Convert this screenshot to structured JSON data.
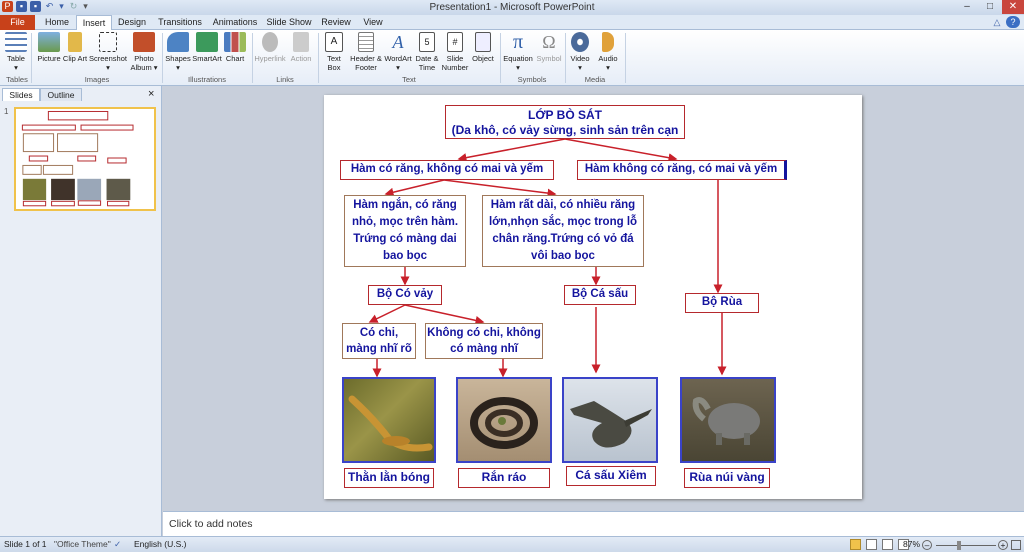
{
  "window": {
    "title": "Presentation1 - Microsoft PowerPoint"
  },
  "tabs": [
    "File",
    "Home",
    "Insert",
    "Design",
    "Transitions",
    "Animations",
    "Slide Show",
    "Review",
    "View"
  ],
  "ribbon": {
    "groups": {
      "tables": "Tables",
      "images": "Images",
      "illustrations": "Illustrations",
      "links": "Links",
      "text": "Text",
      "symbols": "Symbols",
      "media": "Media"
    },
    "buttons": {
      "table": "Table",
      "picture": "Picture",
      "clipart": "Clip Art",
      "screenshot": "Screenshot",
      "photoalbum": "Photo Album",
      "shapes": "Shapes",
      "smartart": "SmartArt",
      "chart": "Chart",
      "hyperlink": "Hyperlink",
      "action": "Action",
      "textbox": "Text Box",
      "headerfooter": "Header & Footer",
      "wordart": "WordArt",
      "datetime": "Date & Time",
      "slidenumber": "Slide Number",
      "object": "Object",
      "equation": "Equation",
      "symbol": "Symbol",
      "video": "Video",
      "audio": "Audio"
    }
  },
  "panel": {
    "tab_slides": "Slides",
    "tab_outline": "Outline",
    "close": "×",
    "slide_number": "1"
  },
  "slide": {
    "title_line1": "LỚP BÒ SÁT",
    "title_line2": "(Da khô, có vảy sừng, sinh sản trên cạn",
    "left_branch": "Hàm có răng, không có mai và yếm",
    "right_branch": "Hàm không có răng, có mai và yếm",
    "short_jaw": "Hàm ngắn, có răng nhỏ, mọc trên hàm. Trứng có màng dai bao bọc",
    "long_jaw": "Hàm rất dài, có nhiều răng lớn,nhọn sắc, mọc trong lỗ chân răng.Trứng có vỏ đá vôi bao bọc",
    "order_scaly": "Bộ Có vảy",
    "order_croc": "Bộ Cá sấu",
    "order_turtle": "Bộ Rùa",
    "has_legs": "Có chi, màng nhĩ rõ",
    "no_legs": "Không có chi, không có màng nhĩ",
    "label_lizard": "Thằn lằn bóng",
    "label_snake": "Rắn ráo",
    "label_croc": "Cá sấu Xiêm",
    "label_turtle": "Rùa núi vàng"
  },
  "notes": {
    "placeholder": "Click to add notes"
  },
  "status": {
    "slide": "Slide 1 of 1",
    "theme": "\"Office Theme\"",
    "language": "English (U.S.)",
    "zoom": "87%"
  }
}
